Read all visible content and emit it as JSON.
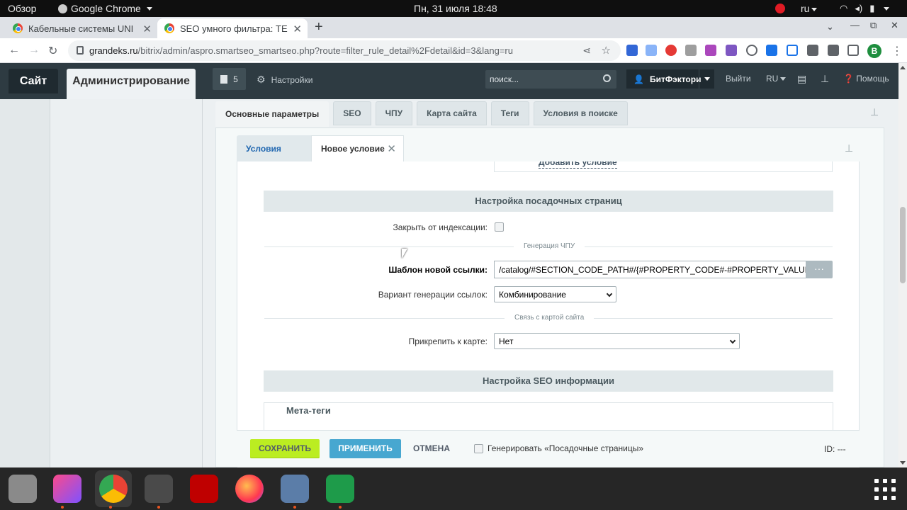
{
  "system_bar": {
    "overview": "Обзор",
    "app_name": "Google Chrome",
    "clock": "Пн, 31 июля  18:48",
    "language": "ru"
  },
  "browser": {
    "tabs": [
      {
        "title": "Кабельные системы UNI",
        "active": false
      },
      {
        "title": "SEO умного фильтра: TE",
        "active": true
      }
    ],
    "url_host": "grandeks.ru",
    "url_path": "/bitrix/admin/aspro.smartseo_smartseo.php?route=filter_rule_detail%2Fdetail&id=3&lang=ru",
    "profile_initial": "B"
  },
  "admin_header": {
    "site_label": "Сайт",
    "admin_label": "Администрирование",
    "notifications_count": "5",
    "settings_label": "Настройки",
    "search_placeholder": "поиск...",
    "user_label": "БитФэктори",
    "logout_label": "Выйти",
    "lang_label": "RU",
    "help_label": "Помощь"
  },
  "main_tabs": [
    {
      "label": "Основные параметры",
      "active": true
    },
    {
      "label": "SEO",
      "active": false
    },
    {
      "label": "ЧПУ",
      "active": false
    },
    {
      "label": "Карта сайта",
      "active": false
    },
    {
      "label": "Теги",
      "active": false
    },
    {
      "label": "Условия в поиске",
      "active": false
    }
  ],
  "sub_tabs": {
    "crumb": "Условия",
    "current": "Новое условие"
  },
  "form": {
    "add_condition": "Добавить условие",
    "section_landing": "Настройка посадочных страниц",
    "noindex_label": "Закрыть от индексации:",
    "divider_chpu": "Генерация ЧПУ",
    "template_label": "Шаблон новой ссылки:",
    "template_value": "/catalog/#SECTION_CODE_PATH#/{#PROPERTY_CODE#-#PROPERTY_VALUE#}",
    "dots_label": "···",
    "variant_label": "Вариант генерации ссылок:",
    "variant_value": "Комбинирование",
    "divider_sitemap": "Связь с картой сайта",
    "attach_label": "Прикрепить к карте:",
    "attach_value": "Нет",
    "section_seo": "Настройка SEO информации",
    "meta_tags": "Мета-теги"
  },
  "footer": {
    "save": "СОХРАНИТЬ",
    "apply": "ПРИМЕНИТЬ",
    "cancel": "ОТМЕНА",
    "generate_label": "Генерировать «Посадочные страницы»",
    "id_label": "ID: ---"
  },
  "dock": {
    "apps": [
      "files-icon",
      "phpstorm-icon",
      "chrome-icon",
      "sublime-text-icon",
      "filezilla-icon",
      "firefox-icon",
      "video-editor-icon",
      "spreadsheet-icon"
    ]
  },
  "colors": {
    "admin_header": "#2e3b42",
    "save_button": "#bbed21",
    "apply_button": "#47a7d0",
    "link_blue": "#2067b0"
  }
}
